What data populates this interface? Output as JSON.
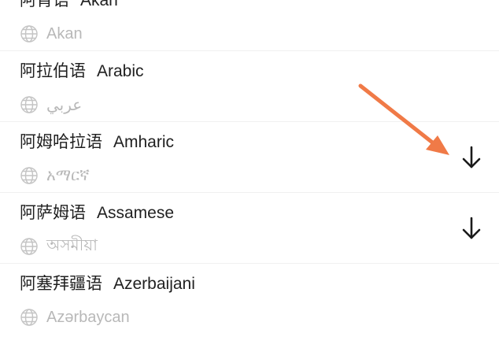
{
  "languages": [
    {
      "native_cn": "阿肯语",
      "english": "Akan",
      "endonym": "Akan",
      "downloadable": false
    },
    {
      "native_cn": "阿拉伯语",
      "english": "Arabic",
      "endonym": "عربي",
      "downloadable": false
    },
    {
      "native_cn": "阿姆哈拉语",
      "english": "Amharic",
      "endonym": "አማርኛ",
      "downloadable": true
    },
    {
      "native_cn": "阿萨姆语",
      "english": "Assamese",
      "endonym": "অসমীয়া",
      "downloadable": true
    },
    {
      "native_cn": "阿塞拜疆语",
      "english": "Azerbaijani",
      "endonym": "Azərbaycan",
      "downloadable": false
    }
  ],
  "icons": {
    "language": "globe-icon",
    "download": "download-arrow-icon",
    "annotation": "orange-pointer-arrow"
  },
  "colors": {
    "title_text": "#1f1f1f",
    "subtitle_text": "#b8b8b8",
    "download_icon": "#1a1a1a",
    "annotation_arrow": "#f07a47",
    "divider": "#f0f0f0"
  }
}
